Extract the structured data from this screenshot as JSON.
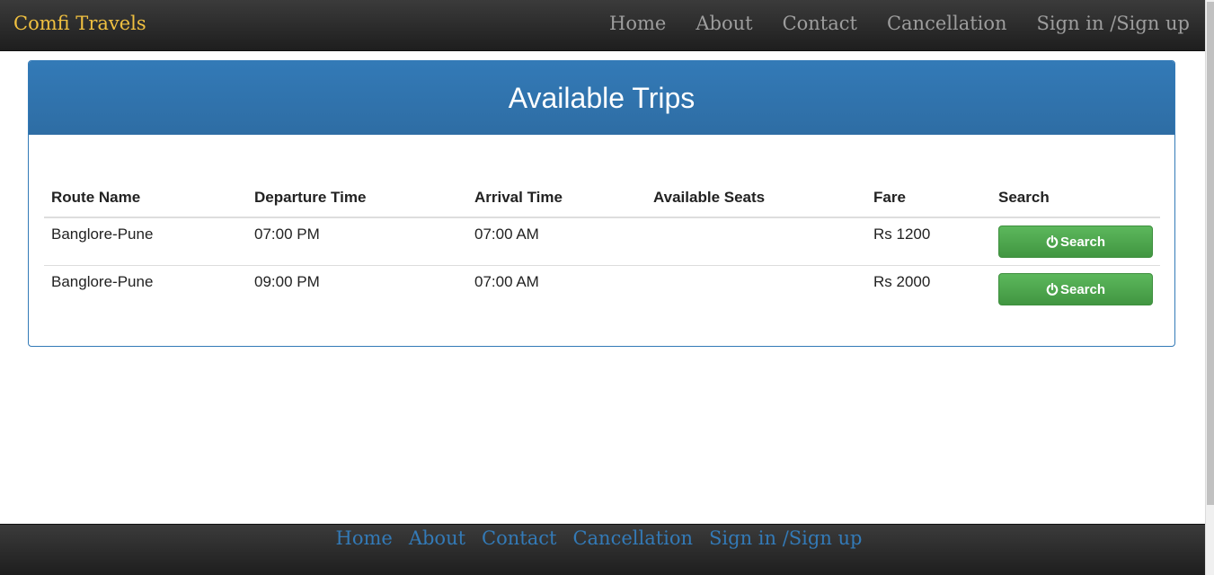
{
  "navbar": {
    "brand": "Comfi Travels",
    "links": [
      "Home",
      "About",
      "Contact",
      "Cancellation",
      "Sign in /Sign up"
    ]
  },
  "panel": {
    "title": "Available Trips"
  },
  "table": {
    "headers": [
      "Route Name",
      "Departure Time",
      "Arrival Time",
      "Available Seats",
      "Fare",
      "Search"
    ],
    "rows": [
      {
        "route": "Banglore-Pune",
        "departure": "07:00 PM",
        "arrival": "07:00 AM",
        "seats": "",
        "fare": "Rs 1200",
        "button": "Search"
      },
      {
        "route": "Banglore-Pune",
        "departure": "09:00 PM",
        "arrival": "07:00 AM",
        "seats": "",
        "fare": "Rs 2000",
        "button": "Search"
      }
    ]
  },
  "footer": {
    "links": [
      "Home",
      "About",
      "Contact",
      "Cancellation",
      "Sign in /Sign up"
    ]
  },
  "colors": {
    "brand": "#f0c040",
    "nav_link": "#9d9d9d",
    "panel_primary": "#337ab7",
    "button_success": "#5cb85c",
    "footer_link": "#337ab7"
  },
  "icons": {
    "search_button_icon": "power-icon"
  }
}
